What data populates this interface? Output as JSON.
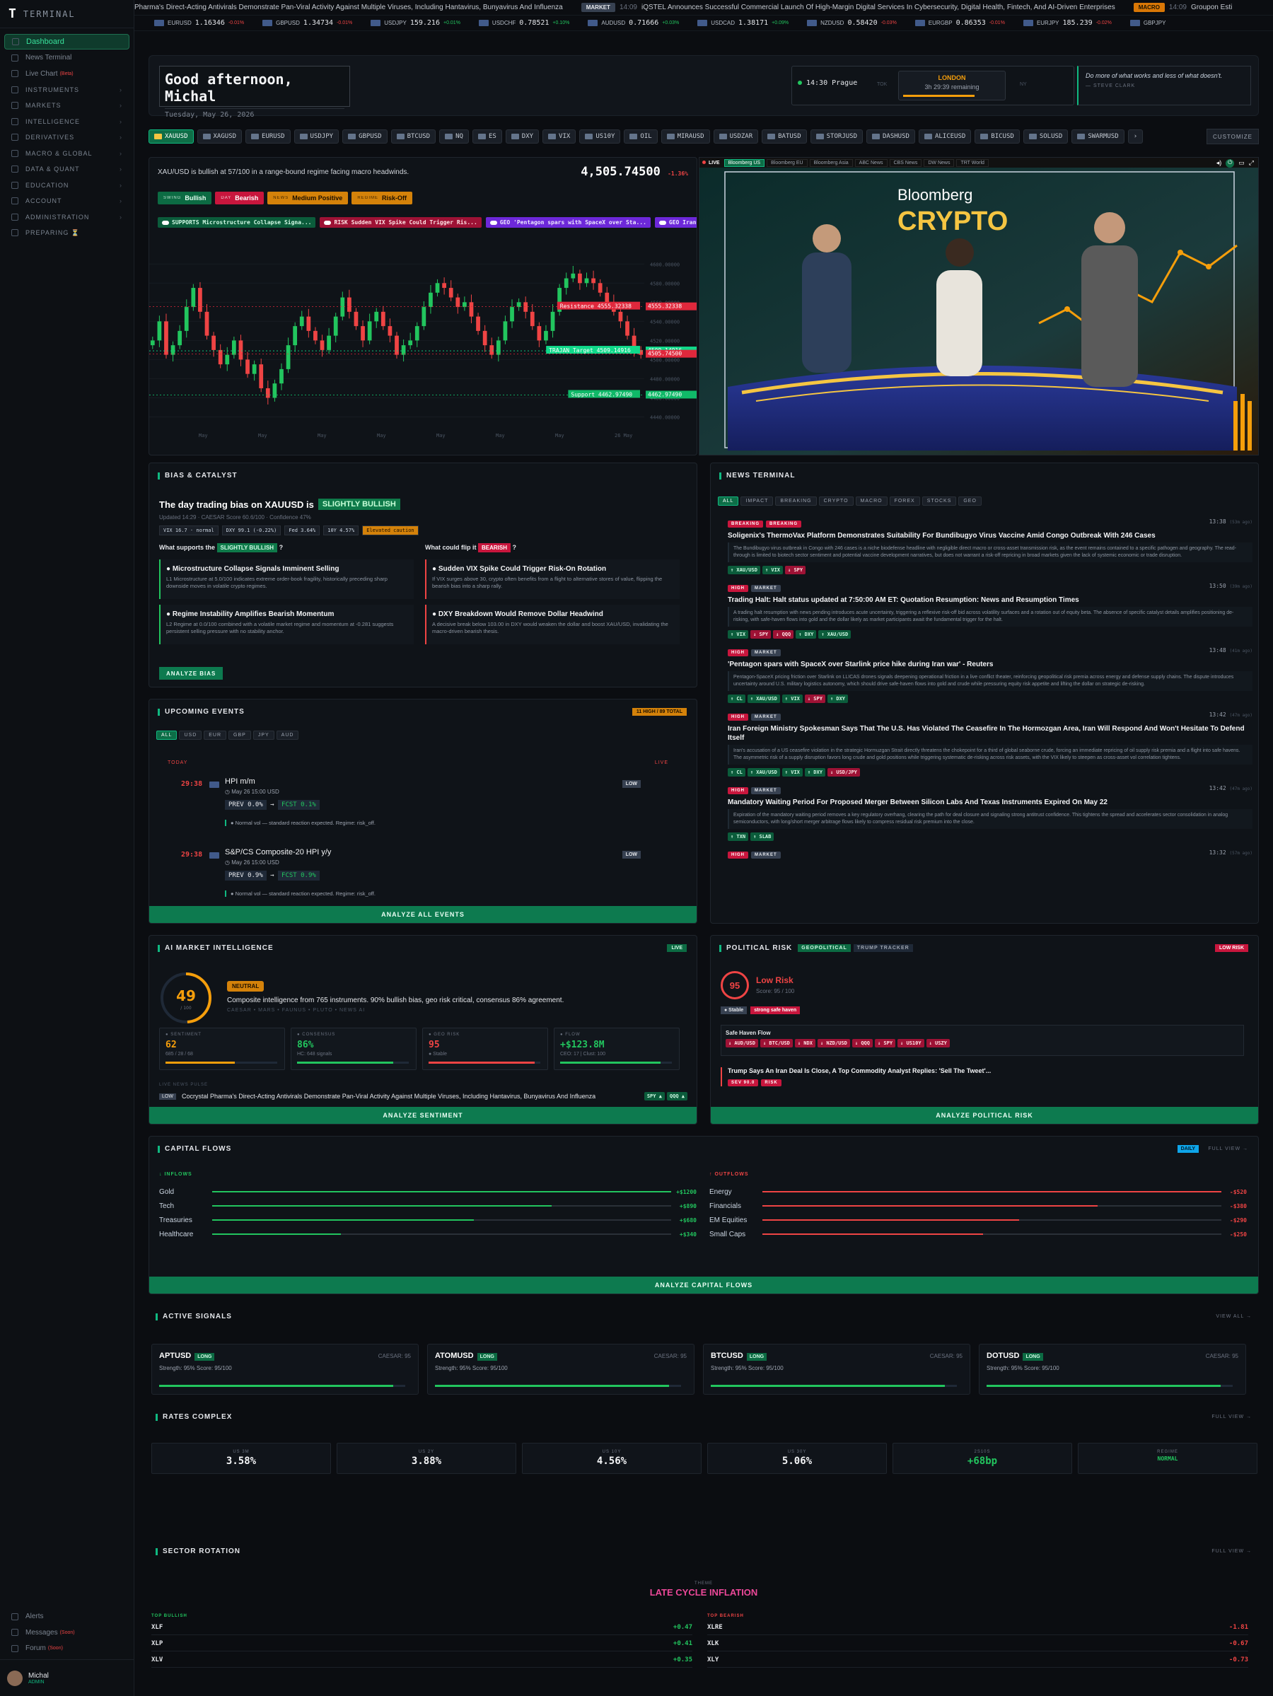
{
  "sidebar": {
    "logo_letter": "T",
    "logo_text": "TERMINAL",
    "items": [
      {
        "label": "Dashboard",
        "active": true
      },
      {
        "label": "News Terminal"
      },
      {
        "label": "Live Chart",
        "badge": "(Beta)"
      }
    ],
    "sections": [
      "INSTRUMENTS",
      "MARKETS",
      "INTELLIGENCE",
      "DERIVATIVES",
      "MACRO & GLOBAL",
      "DATA & QUANT",
      "EDUCATION",
      "ACCOUNT",
      "ADMINISTRATION"
    ],
    "preparing": "PREPARING",
    "bottom": [
      {
        "label": "Alerts"
      },
      {
        "label": "Messages",
        "badge": "(Soon)"
      },
      {
        "label": "Forum",
        "badge": "(Soon)"
      }
    ],
    "user_name": "Michal",
    "user_role": "ADMIN"
  },
  "ticker": {
    "head_text": "Pharma's Direct-Acting Antivirals Demonstrate Pan-Viral Activity Against Multiple Viruses, Including Hantavirus, Bunyavirus And Influenza",
    "items": [
      {
        "tag": "MARKET",
        "time": "14:09",
        "text": "iQSTEL Announces Successful Commercial Launch Of High-Margin Digital Services In Cybersecurity, Digital Health, Fintech, And AI-Driven Enterprises"
      },
      {
        "tag": "MACRO",
        "time": "14:09",
        "text": "Groupon Esti"
      }
    ]
  },
  "fx": [
    {
      "sym": "EURUSD",
      "px": "1.16346",
      "ch": "-0.01%",
      "dir": "dn"
    },
    {
      "sym": "GBPUSD",
      "px": "1.34734",
      "ch": "-0.01%",
      "dir": "dn"
    },
    {
      "sym": "USDJPY",
      "px": "159.216",
      "ch": "+0.01%",
      "dir": "up"
    },
    {
      "sym": "USDCHF",
      "px": "0.78521",
      "ch": "+0.10%",
      "dir": "up"
    },
    {
      "sym": "AUDUSD",
      "px": "0.71666",
      "ch": "+0.03%",
      "dir": "up"
    },
    {
      "sym": "USDCAD",
      "px": "1.38171",
      "ch": "+0.09%",
      "dir": "up"
    },
    {
      "sym": "NZDUSD",
      "px": "0.58420",
      "ch": "-0.03%",
      "dir": "dn"
    },
    {
      "sym": "EURGBP",
      "px": "0.86353",
      "ch": "-0.01%",
      "dir": "dn"
    },
    {
      "sym": "EURJPY",
      "px": "185.239",
      "ch": "-0.02%",
      "dir": "dn"
    },
    {
      "sym": "GBPJPY",
      "px": "",
      "ch": "",
      "dir": "up"
    }
  ],
  "hero": {
    "greeting": "Good afternoon, Michal",
    "date": "Tuesday, May 26, 2026",
    "local_time": "14:30 Prague",
    "session_name": "LONDON",
    "session_remaining": "3h 29:39 remaining",
    "session_progress": 0.72,
    "prev_session": "TOK",
    "next_session": "NY",
    "quote": "Do more of what works and less of what doesn't.",
    "quote_author": "— STEVE CLARK"
  },
  "tabs": [
    "XAUUSD",
    "XAGUSD",
    "EURUSD",
    "USDJPY",
    "GBPUSD",
    "BTCUSD",
    "NQ",
    "ES",
    "DXY",
    "VIX",
    "US10Y",
    "OIL",
    "MIRAUSD",
    "USDZAR",
    "BATUSD",
    "STORJUSD",
    "DASHUSD",
    "ALICEUSD",
    "BICUSD",
    "SOLUSD",
    "SWARMUSD"
  ],
  "tabs_more": "›",
  "customize": "CUSTOMIZE",
  "xau": {
    "summary": "XAU/USD is bullish at 57/100 in a range-bound regime facing macro headwinds.",
    "price": "4,505.74500",
    "change": "-1.36%",
    "chips": [
      {
        "k": "SWING",
        "v": "Bullish",
        "c": "g"
      },
      {
        "k": "DAY",
        "v": "Bearish",
        "c": "r"
      },
      {
        "k": "NEWS",
        "v": "Medium Positive",
        "c": "o"
      },
      {
        "k": "REGIME",
        "v": "Risk-Off",
        "c": "o"
      }
    ],
    "signals": [
      {
        "t": "SUPPORTS Microstructure Collapse Signa...",
        "c": "g"
      },
      {
        "t": "RISK Sudden VIX Spike Could Trigger Ris...",
        "c": "r"
      },
      {
        "t": "GEO 'Pentagon spars with SpaceX over Sta...",
        "c": "p"
      },
      {
        "t": "GEO Iran Fo",
        "c": "p"
      }
    ]
  },
  "chart_data": {
    "type": "candlestick",
    "symbol": "XAUUSD",
    "y_ticks": [
      "4600.00000",
      "4580.00000",
      "4560.00000",
      "4540.00000",
      "4520.00000",
      "4500.00000",
      "4480.00000",
      "4460.00000",
      "4440.00000"
    ],
    "x_ticks": [
      "May",
      "May",
      "May",
      "May",
      "May",
      "May",
      "May",
      "26 May"
    ],
    "ylim": [
      4430,
      4615
    ],
    "levels": [
      {
        "label": "Resistance 4555.32338",
        "value": 4555.32,
        "axis": "4555.32338",
        "color": "#e0283c"
      },
      {
        "label": "TRAJAN Target 4509.14916",
        "value": 4509.15,
        "axis": "4509.14916",
        "color": "#10d98a"
      },
      {
        "label": "",
        "value": 4505.75,
        "axis": "4505.74500",
        "color": "#e0283c"
      },
      {
        "label": "Support 4462.97490",
        "value": 4462.97,
        "axis": "4462.97490",
        "color": "#10b968"
      }
    ],
    "close": [
      4520,
      4540,
      4505,
      4515,
      4530,
      4555,
      4575,
      4550,
      4525,
      4510,
      4495,
      4505,
      4520,
      4500,
      4485,
      4495,
      4470,
      4460,
      4475,
      4490,
      4515,
      4535,
      4545,
      4530,
      4520,
      4510,
      4525,
      4545,
      4565,
      4550,
      4535,
      4520,
      4540,
      4550,
      4535,
      4525,
      4505,
      4515,
      4520,
      4535,
      4555,
      4570,
      4580,
      4575,
      4565,
      4555,
      4560,
      4545,
      4530,
      4515,
      4505,
      4520,
      4540,
      4555,
      4560,
      4550,
      4535,
      4520,
      4530,
      4550,
      4575,
      4585,
      4590,
      4580,
      4585,
      4580,
      4570,
      4560,
      4550,
      4540,
      4525,
      4510,
      4505
    ]
  },
  "video": {
    "live": "LIVE",
    "channels": [
      "Bloomberg US",
      "Bloomberg EU",
      "Bloomberg Asia",
      "ABC News",
      "CBS News",
      "DW News",
      "TRT World"
    ],
    "active": 0,
    "brand": "Bloomberg",
    "show": "CRYPTO"
  },
  "bias": {
    "title": "BIAS & CATALYST",
    "headline": "The day trading bias on XAUUSD is",
    "bias": "SLIGHTLY BULLISH",
    "updated": "Updated 14:29 · CAESAR Score 60.6/100 · Confidence 47%",
    "pills": [
      "VIX 16.7 · normal",
      "DXY 99.1 (-0.22%)",
      "Fed 3.64%",
      "10Y 4.57%",
      "Elevated caution"
    ],
    "supports_label": "What supports the",
    "supports_chip": "SLIGHTLY BULLISH",
    "flip_label": "What could flip it",
    "flip_chip": "BEARISH",
    "supports": [
      {
        "h": "Microstructure Collapse Signals Imminent Selling",
        "b": "L1 Microstructure at 5.0/100 indicates extreme order-book fragility, historically preceding sharp downside moves in volatile crypto regimes."
      },
      {
        "h": "Regime Instability Amplifies Bearish Momentum",
        "b": "L2 Regime at 0.0/100 combined with a volatile market regime and momentum at -0.281 suggests persistent selling pressure with no stability anchor."
      }
    ],
    "flips": [
      {
        "h": "Sudden VIX Spike Could Trigger Risk-On Rotation",
        "b": "If VIX surges above 30, crypto often benefits from a flight to alternative stores of value, flipping the bearish bias into a sharp rally."
      },
      {
        "h": "DXY Breakdown Would Remove Dollar Headwind",
        "b": "A decisive break below 103.00 in DXY would weaken the dollar and boost XAU/USD, invalidating the macro-driven bearish thesis."
      }
    ],
    "button": "ANALYZE BIAS"
  },
  "events": {
    "title": "UPCOMING EVENTS",
    "badge": "11 HIGH / 89 TOTAL",
    "filters": [
      "ALL",
      "USD",
      "EUR",
      "GBP",
      "JPY",
      "AUD"
    ],
    "today": "TODAY",
    "live": "LIVE",
    "items": [
      {
        "cd": "29:38",
        "name": "HPI m/m",
        "date": "May 26 15:00",
        "cur": "USD",
        "impact": "LOW",
        "prev": "0.0%",
        "fcst": "0.1%",
        "note": "Normal vol — standard reaction expected. Regime: risk_off."
      },
      {
        "cd": "29:38",
        "name": "S&P/CS Composite-20 HPI y/y",
        "date": "May 26 15:00",
        "cur": "USD",
        "impact": "LOW",
        "prev": "0.9%",
        "fcst": "0.9%",
        "note": "Normal vol — standard reaction expected. Regime: risk_off."
      }
    ],
    "prev_label": "PREV",
    "fcst_label": "FCST",
    "button": "ANALYZE ALL EVENTS"
  },
  "news": {
    "title": "NEWS TERMINAL",
    "filters": [
      "ALL",
      "IMPACT",
      "BREAKING",
      "CRYPTO",
      "MACRO",
      "FOREX",
      "STOCKS",
      "GEO"
    ],
    "items": [
      {
        "b": [
          "BREAKING",
          "BREAKING"
        ],
        "t": "13:38",
        "ago": "(53m ago)",
        "h": "Soligenix's ThermoVax Platform Demonstrates Suitability For Bundibugyo Virus Vaccine Amid Congo Outbreak With 246 Cases",
        "body": "The Bundibugyo virus outbreak in Congo with 246 cases is a niche biodefense headline with negligible direct macro or cross-asset transmission risk, as the event remains contained to a specific pathogen and geography. The read-through is limited to biotech sector sentiment and potential vaccine development narratives, but does not warrant a risk-off repricing in broad markets given the lack of systemic economic or trade disruption.",
        "tk": [
          [
            "↑ XAU/USD",
            "u"
          ],
          [
            "↑ VIX",
            "u"
          ],
          [
            "↓ SPY",
            "d"
          ]
        ]
      },
      {
        "b": [
          "HIGH",
          "MARKET"
        ],
        "t": "13:50",
        "ago": "(39m ago)",
        "h": "Trading Halt: Halt status updated at 7:50:00 AM ET: Quotation Resumption: News and Resumption Times",
        "body": "A trading halt resumption with news pending introduces acute uncertainty, triggering a reflexive risk-off bid across volatility surfaces and a rotation out of equity beta. The absence of specific catalyst details amplifies positioning de-risking, with safe-haven flows into gold and the dollar likely as market participants await the fundamental trigger for the halt.",
        "tk": [
          [
            "↑ VIX",
            "u"
          ],
          [
            "↓ SPY",
            "d"
          ],
          [
            "↓ QQQ",
            "d"
          ],
          [
            "↑ DXY",
            "u"
          ],
          [
            "↑ XAU/USD",
            "u"
          ]
        ]
      },
      {
        "b": [
          "HIGH",
          "MARKET"
        ],
        "t": "13:48",
        "ago": "(41m ago)",
        "h": "'Pentagon spars with SpaceX over Starlink price hike during Iran war' - Reuters",
        "body": "Pentagon-SpaceX pricing friction over Starlink on LLICAS drones signals deepening operational friction in a live conflict theater, reinforcing geopolitical risk premia across energy and defense supply chains. The dispute introduces uncertainty around U.S. military logistics autonomy, which should drive safe-haven flows into gold and crude while pressuring equity risk appetite and lifting the dollar on strategic de-risking.",
        "tk": [
          [
            "↑ CL",
            "u"
          ],
          [
            "↑ XAU/USD",
            "u"
          ],
          [
            "↑ VIX",
            "u"
          ],
          [
            "↓ SPY",
            "d"
          ],
          [
            "↑ DXY",
            "u"
          ]
        ]
      },
      {
        "b": [
          "HIGH",
          "MARKET"
        ],
        "t": "13:42",
        "ago": "(47m ago)",
        "h": "Iran Foreign Ministry Spokesman Says That The U.S. Has Violated The Ceasefire In The Hormozgan Area, Iran Will Respond And Won't Hesitate To Defend Itself",
        "body": "Iran's accusation of a US ceasefire violation in the strategic Hormuzgan Strait directly threatens the chokepoint for a third of global seaborne crude, forcing an immediate repricing of oil supply risk premia and a flight into safe havens. The asymmetric risk of a supply disruption favors long crude and gold positions while triggering systematic de-risking across risk assets, with the VIX likely to steepen as cross-asset vol correlation tightens.",
        "tk": [
          [
            "↑ CL",
            "u"
          ],
          [
            "↑ XAU/USD",
            "u"
          ],
          [
            "↑ VIX",
            "u"
          ],
          [
            "↑ DXY",
            "u"
          ],
          [
            "↓ USD/JPY",
            "d"
          ]
        ]
      },
      {
        "b": [
          "HIGH",
          "MARKET"
        ],
        "t": "13:42",
        "ago": "(47m ago)",
        "h": "Mandatory Waiting Period For Proposed Merger Between Silicon Labs And Texas Instruments Expired On May 22",
        "body": "Expiration of the mandatory waiting period removes a key regulatory overhang, clearing the path for deal closure and signaling strong antitrust confidence. This tightens the spread and accelerates sector consolidation in analog semiconductors, with long/short merger arbitrage flows likely to compress residual risk premium into the close.",
        "tk": [
          [
            "↑ TXN",
            "u"
          ],
          [
            "↑ SLAB",
            "u"
          ]
        ]
      },
      {
        "b": [
          "HIGH",
          "MARKET"
        ],
        "t": "13:32",
        "ago": "(57m ago)",
        "h": "",
        "body": "",
        "tk": []
      }
    ]
  },
  "ai": {
    "title": "AI MARKET INTELLIGENCE",
    "live": "LIVE",
    "score": "49",
    "score_sub": "/ 100",
    "label": "NEUTRAL",
    "desc": "Composite intelligence from 765 instruments. 90% bullish bias, geo risk critical, consensus 86% agreement.",
    "sources": "CAESAR • MARS • FAUNUS • PLUTO • NEWS AI",
    "cards": [
      {
        "l": "SENTIMENT",
        "v": "62",
        "s": "685 / 28 / 68",
        "c": "#f59e0b",
        "fill": 0.62
      },
      {
        "l": "CONSENSUS",
        "v": "86%",
        "s": "HC: 648 signals",
        "c": "#22c55e",
        "fill": 0.86
      },
      {
        "l": "GEO RISK",
        "v": "95",
        "s": "● Stable",
        "c": "#ef4444",
        "fill": 0.95
      },
      {
        "l": "FLOW",
        "v": "+$123.8M",
        "s": "CEO: 17 | Clust: 100",
        "c": "#22c55e",
        "fill": 0.9
      }
    ],
    "news_label": "LIVE NEWS PULSE",
    "pulse_tag": "LOW",
    "pulse_text": "Cocrystal Pharma's Direct-Acting Antivirals Demonstrate Pan-Viral Activity Against Multiple Viruses, Including Hantavirus, Bunyavirus And Influenza",
    "pulse_tk": [
      "SPY ▲",
      "QQQ ▲"
    ],
    "button": "ANALYZE SENTIMENT"
  },
  "pol": {
    "title": "POLITICAL RISK",
    "tabs": [
      "GEOPOLITICAL",
      "TRUMP TRACKER"
    ],
    "badge": "LOW RISK",
    "score": "95",
    "level": "Low Risk",
    "score_line": "Score: 95 / 100",
    "stable": "● Stable",
    "haven": "strong safe haven",
    "flow_title": "Safe Haven Flow",
    "flows": [
      "↓ AUD/USD",
      "↓ BTC/USD",
      "↓ NDX",
      "↓ NZD/USD",
      "↓ QQQ",
      "↓ SPY",
      "↓ US10Y",
      "↓ USZY"
    ],
    "headline": "Trump Says An Iran Deal Is Close, A Top Commodity Analyst Replies: 'Sell The Tweet'...",
    "sev": "SEV 90.0",
    "risk": "RISK",
    "button": "ANALYZE POLITICAL RISK"
  },
  "flows": {
    "title": "CAPITAL FLOWS",
    "period": "DAILY",
    "full": "FULL VIEW →",
    "in_label": "INFLOWS",
    "out_label": "OUTFLOWS",
    "inflows": [
      {
        "n": "Gold",
        "v": "+$1200",
        "f": 1.0
      },
      {
        "n": "Tech",
        "v": "+$890",
        "f": 0.74
      },
      {
        "n": "Treasuries",
        "v": "+$680",
        "f": 0.57
      },
      {
        "n": "Healthcare",
        "v": "+$340",
        "f": 0.28
      }
    ],
    "outflows": [
      {
        "n": "Energy",
        "v": "-$520",
        "f": 1.0
      },
      {
        "n": "Financials",
        "v": "-$380",
        "f": 0.73
      },
      {
        "n": "EM Equities",
        "v": "-$290",
        "f": 0.56
      },
      {
        "n": "Small Caps",
        "v": "-$250",
        "f": 0.48
      }
    ],
    "button": "ANALYZE CAPITAL FLOWS"
  },
  "signals": {
    "title": "ACTIVE SIGNALS",
    "all": "VIEW ALL →",
    "items": [
      {
        "s": "APTUSD",
        "d": "LONG",
        "cz": "CAESAR: 95",
        "st": "Strength: 95%    Score: 95/100",
        "f": 0.95
      },
      {
        "s": "ATOMUSD",
        "d": "LONG",
        "cz": "CAESAR: 95",
        "st": "Strength: 95%    Score: 95/100",
        "f": 0.95
      },
      {
        "s": "BTCUSD",
        "d": "LONG",
        "cz": "CAESAR: 95",
        "st": "Strength: 95%    Score: 95/100",
        "f": 0.95
      },
      {
        "s": "DOTUSD",
        "d": "LONG",
        "cz": "CAESAR: 95",
        "st": "Strength: 95%    Score: 95/100",
        "f": 0.95
      }
    ]
  },
  "rates": {
    "title": "RATES COMPLEX",
    "full": "FULL VIEW →",
    "items": [
      {
        "l": "US 3M",
        "v": "3.58%",
        "c": "#f3f4f6"
      },
      {
        "l": "US 2Y",
        "v": "3.88%",
        "c": "#f3f4f6"
      },
      {
        "l": "US 10Y",
        "v": "4.56%",
        "c": "#f3f4f6"
      },
      {
        "l": "US 30Y",
        "v": "5.06%",
        "c": "#f3f4f6"
      },
      {
        "l": "2S10S",
        "v": "+68bp",
        "c": "#22c55e"
      },
      {
        "l": "REGIME",
        "v": "NORMAL",
        "c": "#22c55e"
      }
    ]
  },
  "sector": {
    "title": "SECTOR ROTATION",
    "full": "FULL VIEW →",
    "theme_label": "THEME",
    "theme": "LATE CYCLE INFLATION",
    "bull_label": "TOP BULLISH",
    "bear_label": "TOP BEARISH",
    "bull": [
      {
        "s": "XLF",
        "v": "+0.47"
      },
      {
        "s": "XLP",
        "v": "+0.41"
      },
      {
        "s": "XLV",
        "v": "+0.35"
      }
    ],
    "bear": [
      {
        "s": "XLRE",
        "v": "-1.81"
      },
      {
        "s": "XLK",
        "v": "-0.67"
      },
      {
        "s": "XLY",
        "v": "-0.73"
      }
    ]
  }
}
